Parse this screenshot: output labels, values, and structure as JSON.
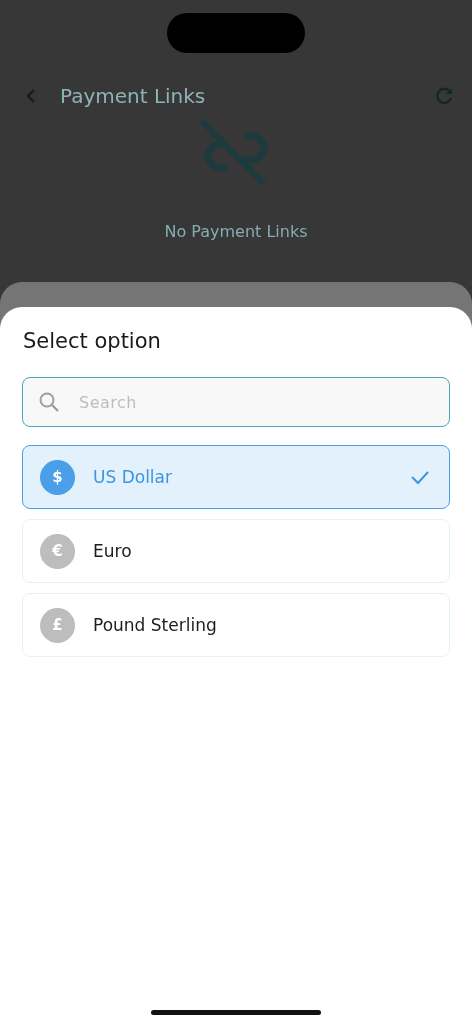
{
  "header": {
    "title": "Payment Links"
  },
  "empty_state": {
    "message": "No Payment Links"
  },
  "sheet": {
    "title": "Select option",
    "search": {
      "placeholder": "Search"
    },
    "options": [
      {
        "symbol": "$",
        "label": "US Dollar",
        "selected": true
      },
      {
        "symbol": "€",
        "label": "Euro",
        "selected": false
      },
      {
        "symbol": "£",
        "label": "Pound Sterling",
        "selected": false
      }
    ]
  }
}
